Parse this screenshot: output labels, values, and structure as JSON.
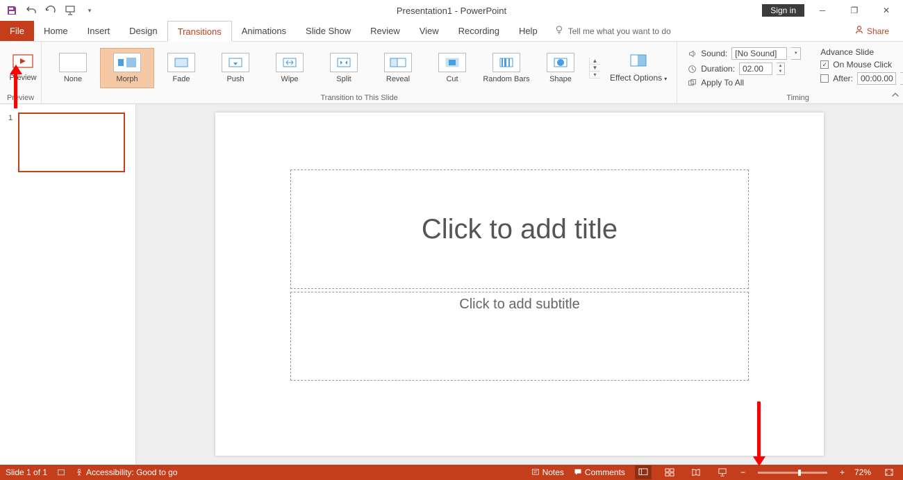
{
  "title": "Presentation1  -  PowerPoint",
  "signin": "Sign in",
  "tabs": {
    "file": "File",
    "home": "Home",
    "insert": "Insert",
    "design": "Design",
    "transitions": "Transitions",
    "animations": "Animations",
    "slideshow": "Slide Show",
    "review": "Review",
    "view": "View",
    "recording": "Recording",
    "help": "Help",
    "tellme": "Tell me what you want to do",
    "share": "Share"
  },
  "ribbon": {
    "preview_label": "Preview",
    "preview_group": "Preview",
    "transitions": {
      "none": "None",
      "morph": "Morph",
      "fade": "Fade",
      "push": "Push",
      "wipe": "Wipe",
      "split": "Split",
      "reveal": "Reveal",
      "cut": "Cut",
      "randombars": "Random Bars",
      "shape": "Shape"
    },
    "transition_group": "Transition to This Slide",
    "effect_options": "Effect Options",
    "sound_label": "Sound:",
    "sound_value": "[No Sound]",
    "duration_label": "Duration:",
    "duration_value": "02.00",
    "apply_all": "Apply To All",
    "advance_label": "Advance Slide",
    "on_click": "On Mouse Click",
    "after_label": "After:",
    "after_value": "00:00.00",
    "timing_group": "Timing"
  },
  "slide": {
    "number": "1",
    "title_placeholder": "Click to add title",
    "subtitle_placeholder": "Click to add subtitle"
  },
  "status": {
    "slide_info": "Slide 1 of 1",
    "accessibility": "Accessibility: Good to go",
    "notes": "Notes",
    "comments": "Comments",
    "zoom": "72%"
  },
  "icons": {
    "check": "✓",
    "lightbulb": "◯",
    "person": "♙",
    "up": "▲",
    "down": "▼",
    "more": "▾"
  }
}
